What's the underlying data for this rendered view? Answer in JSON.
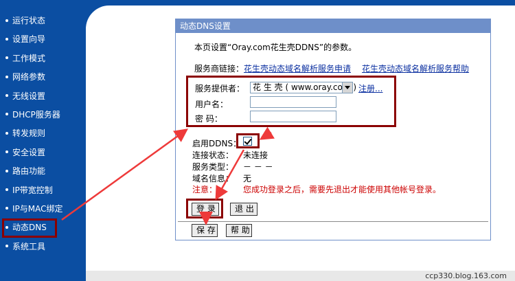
{
  "sidebar": {
    "items": [
      {
        "label": "运行状态"
      },
      {
        "label": "设置向导"
      },
      {
        "label": "工作模式"
      },
      {
        "label": "网络参数"
      },
      {
        "label": "无线设置"
      },
      {
        "label": "DHCP服务器"
      },
      {
        "label": "转发规则"
      },
      {
        "label": "安全设置"
      },
      {
        "label": "路由功能"
      },
      {
        "label": "IP带宽控制"
      },
      {
        "label": "IP与MAC绑定"
      },
      {
        "label": "动态DNS"
      },
      {
        "label": "系统工具"
      }
    ],
    "active_index": 11
  },
  "panel": {
    "title": "动态DNS设置",
    "intro": "本页设置“Oray.com花生壳DDNS”的参数。",
    "provider_links_label": "服务商链接：",
    "link_apply": "花生壳动态域名解析服务申请",
    "link_help": "花生壳动态域名解析服务帮助",
    "provider_label": "服务提供者：",
    "provider_selected": "花 生 壳 ( www.oray.com )",
    "register_link": "注册...",
    "username_label": "用户名：",
    "username_value": "",
    "password_label": "密  码：",
    "password_value": "",
    "enable_ddns_label": "启用DDNS：",
    "enable_ddns_checked": true,
    "conn_status_label": "连接状态：",
    "conn_status_value": "未连接",
    "service_type_label": "服务类型：",
    "service_type_value": "－ － －",
    "domain_info_label": "域名信息：",
    "domain_info_value": "无",
    "note_label": "注意：",
    "note_text": "您成功登录之后，需要先退出才能使用其他帐号登录。",
    "login_button": "登 录",
    "logout_button": "退 出",
    "save_button": "保 存",
    "help_button": "帮 助"
  },
  "watermark": "ccp330.blog.163.com",
  "colors": {
    "sidebar_bg": "#0b4ea2",
    "panel_header": "#6e8fc9",
    "highlight_box": "#8b0000",
    "arrow": "#ee3a3a",
    "note_red": "#cc0000"
  }
}
